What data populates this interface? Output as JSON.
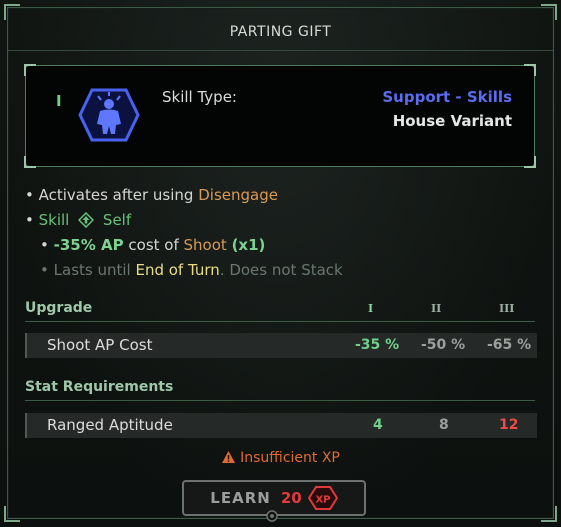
{
  "title": "PARTING GIFT",
  "header": {
    "tier": "I",
    "skill_type_label": "Skill Type:",
    "skill_type_value": "Support - Skills",
    "variant": "House Variant",
    "icon": "support-figure-icon"
  },
  "effects": {
    "line1_prefix": "• Activates after using",
    "line1_keyword": "Disengage",
    "line2_bullet": "•",
    "line2_skill": "Skill",
    "line2_self": "Self",
    "line3_bullet": "•",
    "line3_value": "-35% AP",
    "line3_mid": "cost of",
    "line3_keyword": "Shoot",
    "line3_mult": "(x1)",
    "line4_bullet": "•",
    "line4_prefix": "Lasts until",
    "line4_keyword": "End of Turn",
    "line4_suffix": ". Does not Stack"
  },
  "upgrade": {
    "heading": "Upgrade",
    "tiers": [
      "I",
      "II",
      "III"
    ],
    "rows": [
      {
        "label": "Shoot AP Cost",
        "values": [
          "-35 %",
          "-50 %",
          "-65 %"
        ]
      }
    ]
  },
  "requirements": {
    "heading": "Stat Requirements",
    "rows": [
      {
        "label": "Ranged Aptitude",
        "values": [
          "4",
          "8",
          "12"
        ]
      }
    ]
  },
  "warning": "Insufficient XP",
  "learn_button": {
    "label": "LEARN",
    "cost": "20",
    "badge": "XP"
  },
  "colors": {
    "accent_green": "#68c27a",
    "keyword_orange": "#d99a55",
    "skill_type_blue": "#5a6cf2",
    "warning_orange": "#e06a33",
    "insufficient_red": "#e23a3a"
  }
}
